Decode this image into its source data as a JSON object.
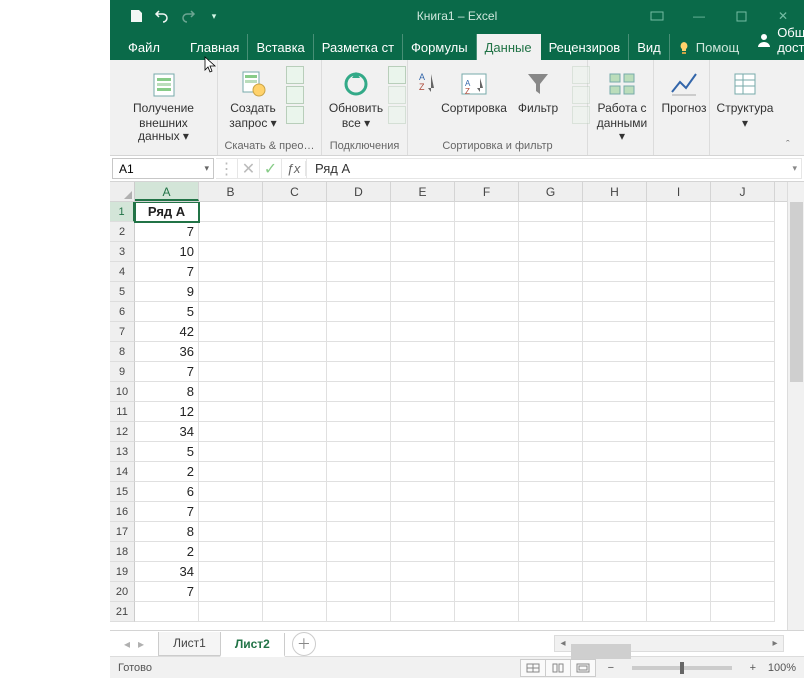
{
  "colors": {
    "brand": "#0a6a49",
    "accent": "#217346"
  },
  "title": "Книга1 – Excel",
  "tabs": {
    "file": "Файл",
    "items": [
      "Главная",
      "Вставка",
      "Разметка ст",
      "Формулы",
      "Данные",
      "Рецензиров",
      "Вид"
    ],
    "active_index": 4,
    "tell": "Помощ",
    "share": "Общий доступ"
  },
  "ribbon": {
    "groups": [
      {
        "label": "",
        "big": {
          "line1": "Получение",
          "line2": "внешних данных ▾"
        }
      },
      {
        "label": "Скачать & прео…",
        "big": {
          "line1": "Создать",
          "line2": "запрос ▾"
        }
      },
      {
        "label": "Подключения",
        "big": {
          "line1": "Обновить",
          "line2": "все ▾"
        }
      },
      {
        "label": "Сортировка и фильтр",
        "btns": [
          {
            "line1": "",
            "line2": ""
          },
          {
            "line1": "Сортировка",
            "line2": ""
          },
          {
            "line1": "Фильтр",
            "line2": ""
          }
        ]
      },
      {
        "label": "",
        "big": {
          "line1": "Работа с",
          "line2": "данными ▾"
        }
      },
      {
        "label": "",
        "big": {
          "line1": "Прогноз",
          "line2": ""
        }
      },
      {
        "label": "",
        "big": {
          "line1": "Структура",
          "line2": "▾"
        }
      }
    ]
  },
  "namebox": "A1",
  "formula": "Ряд А",
  "columns": [
    "A",
    "B",
    "C",
    "D",
    "E",
    "F",
    "G",
    "H",
    "I",
    "J"
  ],
  "selected_col_index": 0,
  "rows": [
    {
      "n": 1,
      "a": "Ряд А",
      "bold": true
    },
    {
      "n": 2,
      "a": "7"
    },
    {
      "n": 3,
      "a": "10"
    },
    {
      "n": 4,
      "a": "7"
    },
    {
      "n": 5,
      "a": "9"
    },
    {
      "n": 6,
      "a": "5"
    },
    {
      "n": 7,
      "a": "42"
    },
    {
      "n": 8,
      "a": "36"
    },
    {
      "n": 9,
      "a": "7"
    },
    {
      "n": 10,
      "a": "8"
    },
    {
      "n": 11,
      "a": "12"
    },
    {
      "n": 12,
      "a": "34"
    },
    {
      "n": 13,
      "a": "5"
    },
    {
      "n": 14,
      "a": "2"
    },
    {
      "n": 15,
      "a": "6"
    },
    {
      "n": 16,
      "a": "7"
    },
    {
      "n": 17,
      "a": "8"
    },
    {
      "n": 18,
      "a": "2"
    },
    {
      "n": 19,
      "a": "34"
    },
    {
      "n": 20,
      "a": "7"
    },
    {
      "n": 21,
      "a": ""
    }
  ],
  "selected_cell": {
    "row": 1,
    "col": 0
  },
  "sheets": {
    "items": [
      "Лист1",
      "Лист2"
    ],
    "active_index": 1
  },
  "status": {
    "ready": "Готово",
    "zoom": "100%"
  }
}
